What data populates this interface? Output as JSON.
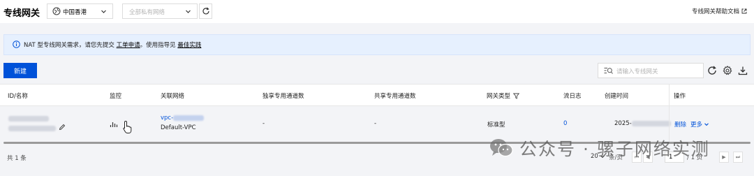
{
  "header": {
    "title": "专线网关",
    "region": "中国香港",
    "network_placeholder": "全部私有网络",
    "help_link": "专线网关帮助文档"
  },
  "notice": {
    "prefix": "NAT 型专线网关需求，请您先提交",
    "link1": "工单申请",
    "middle": "。使用指导见",
    "link2": "最佳实践"
  },
  "toolbar": {
    "new_label": "新建",
    "search_placeholder": "请输入专线网关"
  },
  "table": {
    "columns": {
      "id": "ID/名称",
      "monitor": "监控",
      "network": "关联网络",
      "exclusive": "独享专用通道数",
      "shared": "共享专用通道数",
      "type": "网关类型",
      "flowlog": "流日志",
      "created": "创建时间",
      "ops": "操作"
    },
    "rows": [
      {
        "vpc_prefix": "vpc-",
        "vpc_name": "Default-VPC",
        "exclusive": "-",
        "shared": "-",
        "type": "标准型",
        "flowlog": "0",
        "created_prefix": "2025-",
        "delete_label": "删除",
        "more_label": "更多"
      }
    ]
  },
  "footer": {
    "total": "共 1 条",
    "page_size": "20",
    "per_page": "条/页",
    "page": "1",
    "of_pages": "/ 1 页"
  },
  "watermark": {
    "text": "公众号 · 骡子网络实测"
  },
  "colors": {
    "primary": "#0052d9",
    "notice_bg": "#e6f0fe",
    "page_bg": "#f3f4f7"
  }
}
